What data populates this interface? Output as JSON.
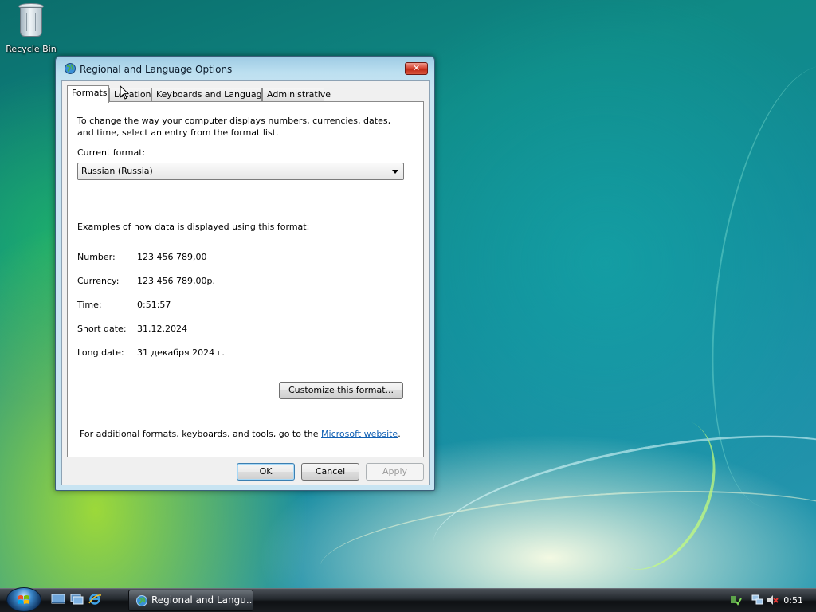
{
  "desktop": {
    "icons": [
      {
        "label": "Recycle Bin",
        "icon": "recycle-bin-icon"
      }
    ]
  },
  "window": {
    "title": "Regional and Language Options",
    "close_glyph": "✕",
    "tabs": [
      {
        "label": "Formats",
        "active": true
      },
      {
        "label": "Location",
        "active": false
      },
      {
        "label": "Keyboards and Languages",
        "active": false
      },
      {
        "label": "Administrative",
        "active": false
      }
    ],
    "formats": {
      "intro": "To change the way your computer displays numbers, currencies, dates, and time, select an entry from the format list.",
      "current_format_label": "Current format:",
      "current_format_value": "Russian (Russia)",
      "examples_heading": "Examples of how data is displayed using this format:",
      "examples": [
        {
          "label": "Number:",
          "value": "123 456 789,00"
        },
        {
          "label": "Currency:",
          "value": "123 456 789,00р."
        },
        {
          "label": "Time:",
          "value": "0:51:57"
        },
        {
          "label": "Short date:",
          "value": "31.12.2024"
        },
        {
          "label": "Long date:",
          "value": "31 декабря 2024 г."
        }
      ],
      "customize_button": "Customize this format...",
      "additional_prefix": "For additional formats, keyboards, and tools, go to the ",
      "additional_link": "Microsoft website",
      "additional_suffix": "."
    },
    "buttons": {
      "ok": "OK",
      "cancel": "Cancel",
      "apply": "Apply"
    }
  },
  "taskbar": {
    "task_button": "Regional and Langu...",
    "clock": "0:51",
    "quick_launch": [
      "show-desktop-icon",
      "switch-windows-icon",
      "internet-explorer-icon"
    ],
    "tray_icons": [
      "windows-update-icon",
      "network-icon",
      "volume-muted-icon"
    ]
  }
}
